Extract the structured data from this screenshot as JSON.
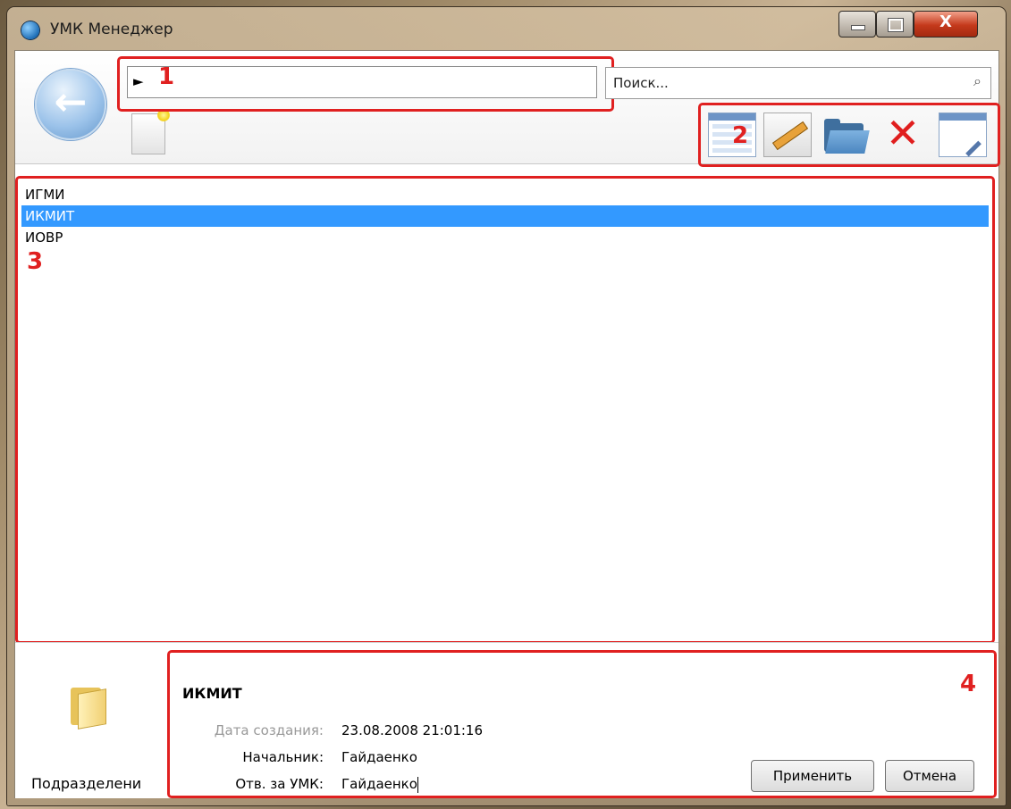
{
  "window": {
    "title": "УМК Менеджер",
    "close_glyph": "X"
  },
  "breadcrumb": {
    "arrow": "►"
  },
  "search": {
    "placeholder": "Поиск..."
  },
  "annotations": {
    "n1": "1",
    "n2": "2",
    "n3": "3",
    "n4": "4"
  },
  "toolbar": {
    "icons": [
      "table-icon",
      "edit-icon",
      "open-folder-icon",
      "delete-icon",
      "properties-icon"
    ],
    "delete_glyph": "✕"
  },
  "list": {
    "items": [
      {
        "label": "ИГМИ",
        "selected": false
      },
      {
        "label": "ИКМИТ",
        "selected": true
      },
      {
        "label": "ИОВР",
        "selected": false
      }
    ]
  },
  "details": {
    "folder_caption": "Подразделени",
    "title": "ИКМИТ",
    "created_label": "Дата создания:",
    "created_value": "23.08.2008 21:01:16",
    "head_label": "Начальник:",
    "head_value": "Гайдаенко",
    "resp_label": "Отв. за УМК:",
    "resp_value": "Гайдаенко",
    "apply_label": "Применить",
    "cancel_label": "Отмена"
  },
  "colors": {
    "annotation": "#e02020",
    "selection": "#3399ff"
  }
}
